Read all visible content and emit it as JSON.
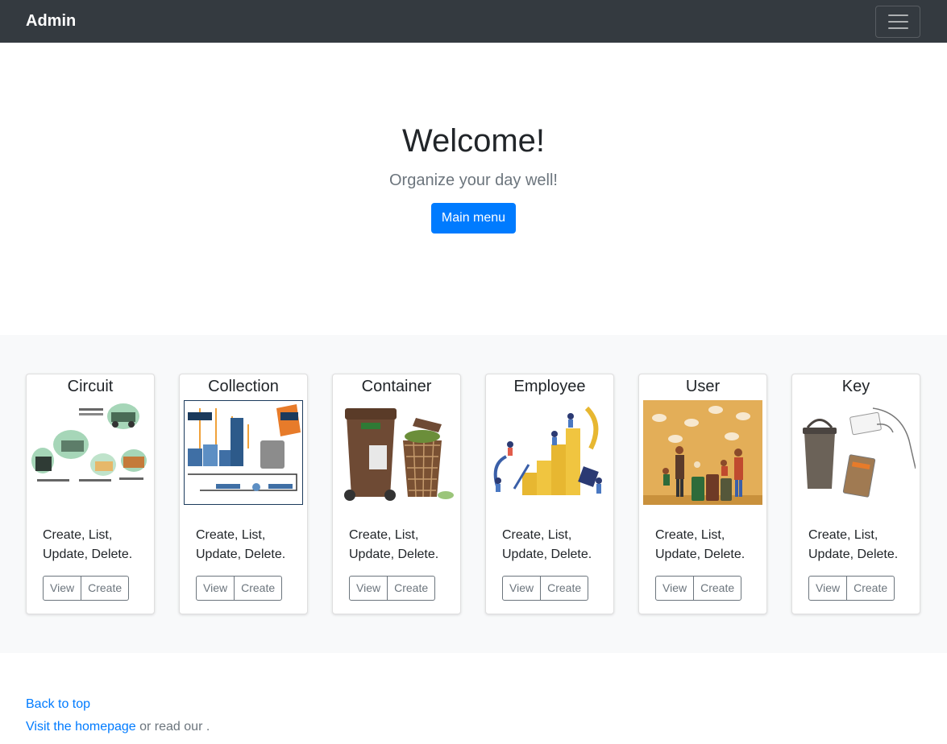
{
  "navbar": {
    "brand": "Admin"
  },
  "hero": {
    "title": "Welcome!",
    "subtitle": "Organize your day well!",
    "button": "Main menu"
  },
  "cards": [
    {
      "title": "Circuit",
      "text": "Create, List, Update, Delete.",
      "view": "View",
      "create": "Create"
    },
    {
      "title": "Collection",
      "text": "Create, List, Update, Delete.",
      "view": "View",
      "create": "Create"
    },
    {
      "title": "Container",
      "text": "Create, List, Update, Delete.",
      "view": "View",
      "create": "Create"
    },
    {
      "title": "Employee",
      "text": "Create, List, Update, Delete.",
      "view": "View",
      "create": "Create"
    },
    {
      "title": "User",
      "text": "Create, List, Update, Delete.",
      "view": "View",
      "create": "Create"
    },
    {
      "title": "Key",
      "text": "Create, List, Update, Delete.",
      "view": "View",
      "create": "Create"
    }
  ],
  "footer": {
    "back_to_top": "Back to top",
    "homepage_link": "Visit the homepage",
    "rest": " or read our ."
  }
}
